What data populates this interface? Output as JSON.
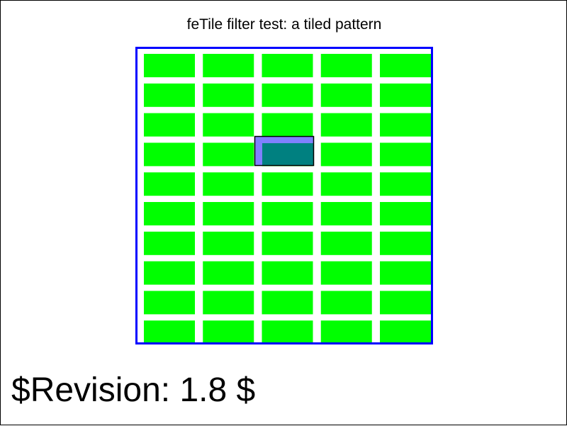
{
  "title": "feTile filter test: a tiled pattern",
  "revision": "$Revision: 1.8 $",
  "colors": {
    "tile": "#00ff00",
    "border": "#0000ff",
    "source_fill": "#008080",
    "source_overlay": "#8080ff",
    "background": "#ffffff",
    "frame": "#000000"
  },
  "tiling": {
    "rows": 10,
    "columns": 5,
    "source_tile_row": 4,
    "source_tile_column": 3
  }
}
